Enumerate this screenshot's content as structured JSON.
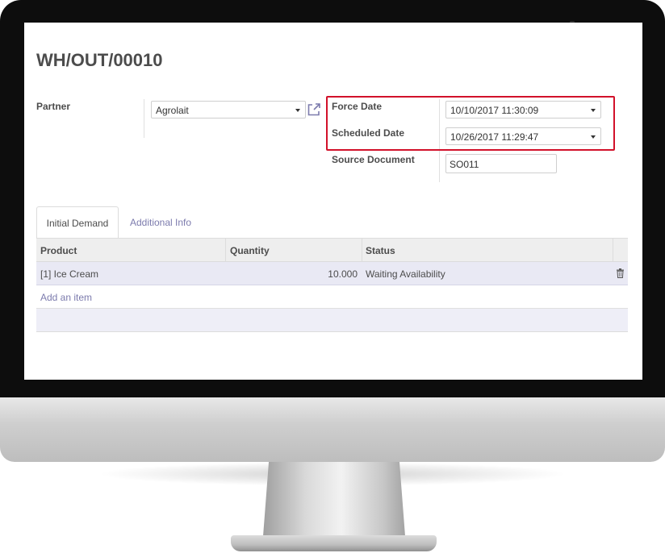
{
  "record": {
    "title": "WH/OUT/00010"
  },
  "fields": {
    "partner": {
      "label": "Partner",
      "value": "Agrolait"
    },
    "force_date": {
      "label": "Force Date",
      "value": "10/10/2017 11:30:09"
    },
    "scheduled_date": {
      "label": "Scheduled Date",
      "value": "10/26/2017 11:29:47"
    },
    "source_document": {
      "label": "Source Document",
      "value": "SO011"
    }
  },
  "tabs": [
    {
      "label": "Initial Demand",
      "active": true
    },
    {
      "label": "Additional Info",
      "active": false
    }
  ],
  "table": {
    "headers": [
      "Product",
      "Quantity",
      "Status"
    ],
    "rows": [
      {
        "product": "[1] Ice Cream",
        "quantity": "10.000",
        "status": "Waiting Availability"
      }
    ],
    "add_item_label": "Add an item"
  },
  "icons": {
    "external_link": "external-link-icon",
    "delete": "trash-icon",
    "dropdown": "caret-down-icon"
  },
  "colors": {
    "highlight_box": "#d2112a",
    "link": "#7c7bad",
    "row_background": "#e9e9f4",
    "header_background": "#eeeeee"
  }
}
